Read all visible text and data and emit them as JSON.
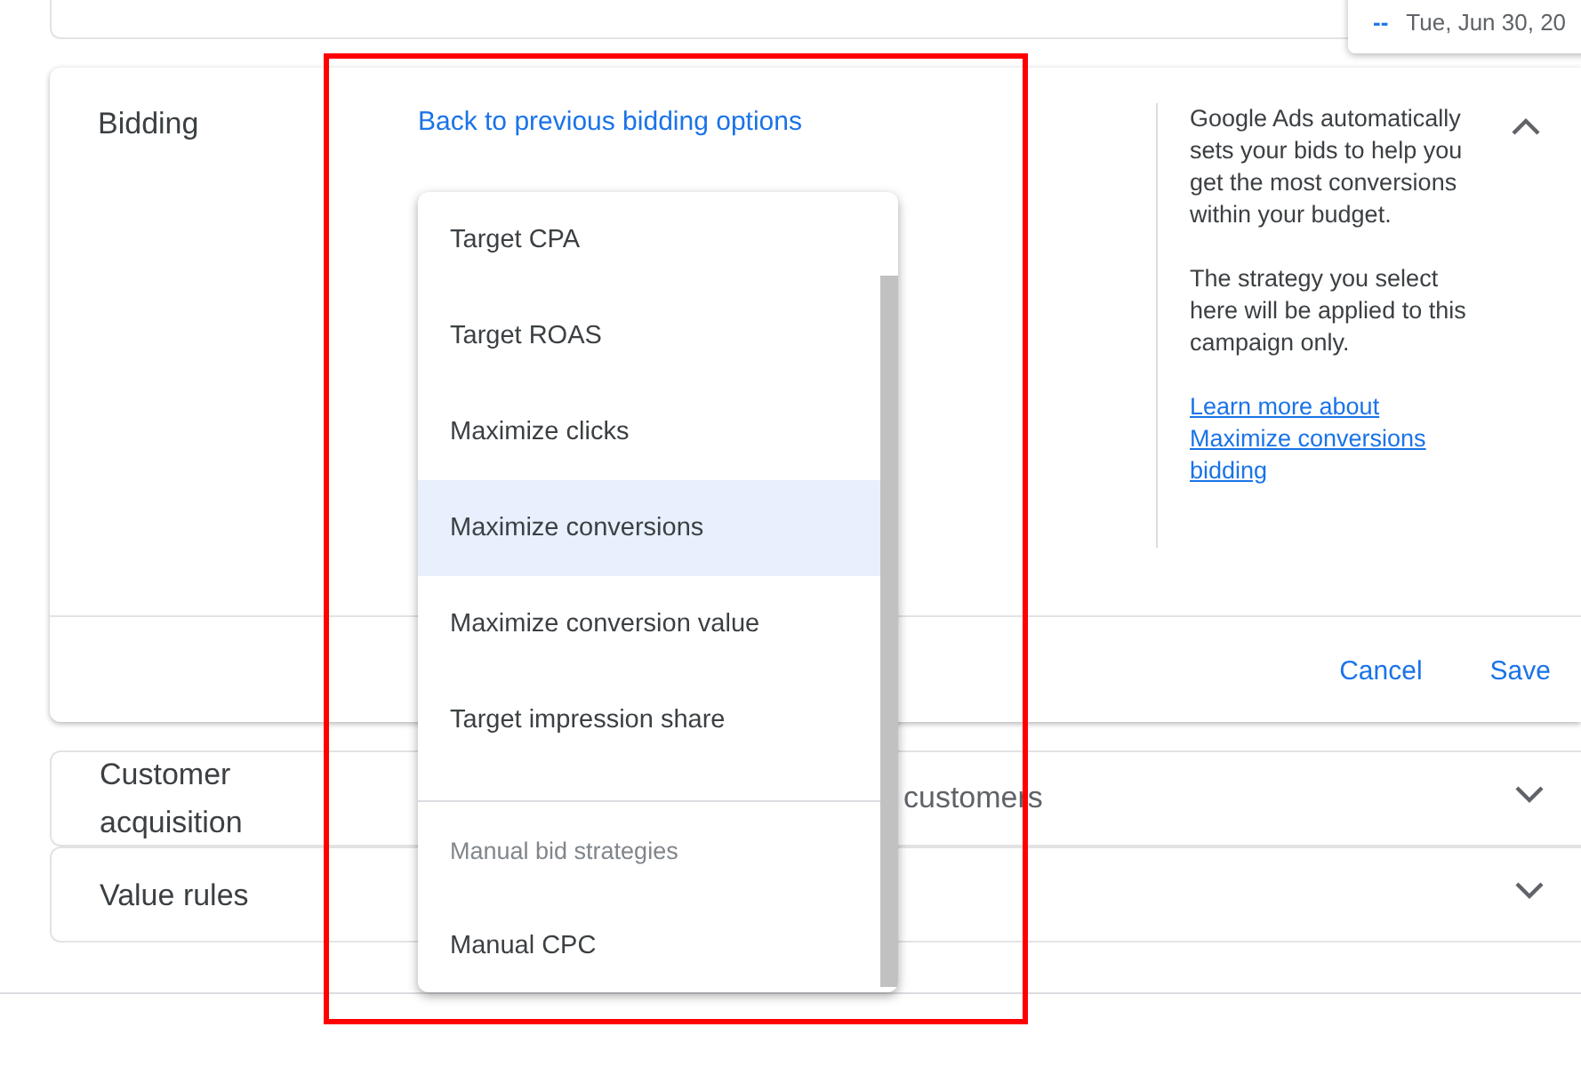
{
  "date_popup": {
    "marker": "--",
    "date": "Tue, Jun 30, 20"
  },
  "bidding": {
    "title": "Bidding",
    "back_link": "Back to previous bidding options",
    "expanded": true,
    "help_paragraphs": [
      "Google Ads automatically sets your bids to help you get the most conversions within your budget.",
      "The strategy you select here will be applied to this campaign only."
    ],
    "learn_more_link": "Learn more about Maximize conversions bidding",
    "buttons": [
      "Cancel",
      "Save"
    ]
  },
  "strategy_menu": {
    "items": [
      {
        "kind": "option",
        "label": "Target CPA",
        "selected": false
      },
      {
        "kind": "option",
        "label": "Target ROAS",
        "selected": false
      },
      {
        "kind": "option",
        "label": "Maximize clicks",
        "selected": false
      },
      {
        "kind": "option",
        "label": "Maximize conversions",
        "selected": true
      },
      {
        "kind": "option",
        "label": "Maximize conversion value",
        "selected": false
      },
      {
        "kind": "option",
        "label": "Target impression share",
        "selected": false
      },
      {
        "kind": "divider"
      },
      {
        "kind": "header",
        "label": "Manual bid strategies"
      },
      {
        "kind": "option",
        "label": "Manual CPC",
        "selected": false
      }
    ]
  },
  "sections": [
    {
      "title": "Customer acquisition",
      "summary": "customers",
      "expanded": false
    },
    {
      "title": "Value rules",
      "expanded": false
    }
  ]
}
